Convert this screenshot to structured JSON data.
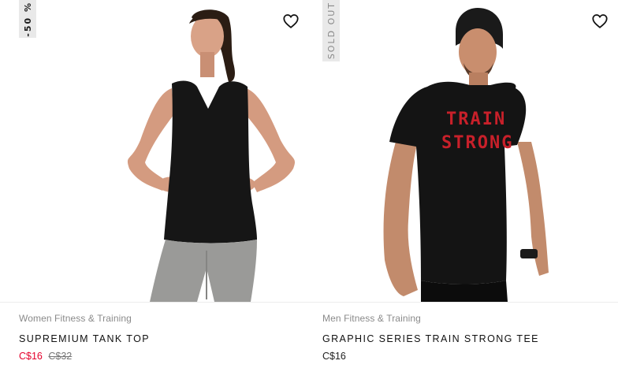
{
  "products": [
    {
      "badge": "-50 %",
      "category": "Women Fitness & Training",
      "title": "SUPREMIUM TANK TOP",
      "price_sale": "C$16",
      "price_original": "C$32",
      "wishlist_icon": "heart-outline-icon"
    },
    {
      "badge": "SOLD OUT",
      "category": "Men Fitness & Training",
      "title": "GRAPHIC SERIES TRAIN STRONG TEE",
      "price": "C$16",
      "wishlist_icon": "heart-outline-icon",
      "shirt_graphic_line1": "TRAIN",
      "shirt_graphic_line2": "STRONG"
    }
  ],
  "colors": {
    "sale": "#e4002b",
    "badge_bg": "#e9e9e9",
    "graphic_red": "#c8202a"
  }
}
